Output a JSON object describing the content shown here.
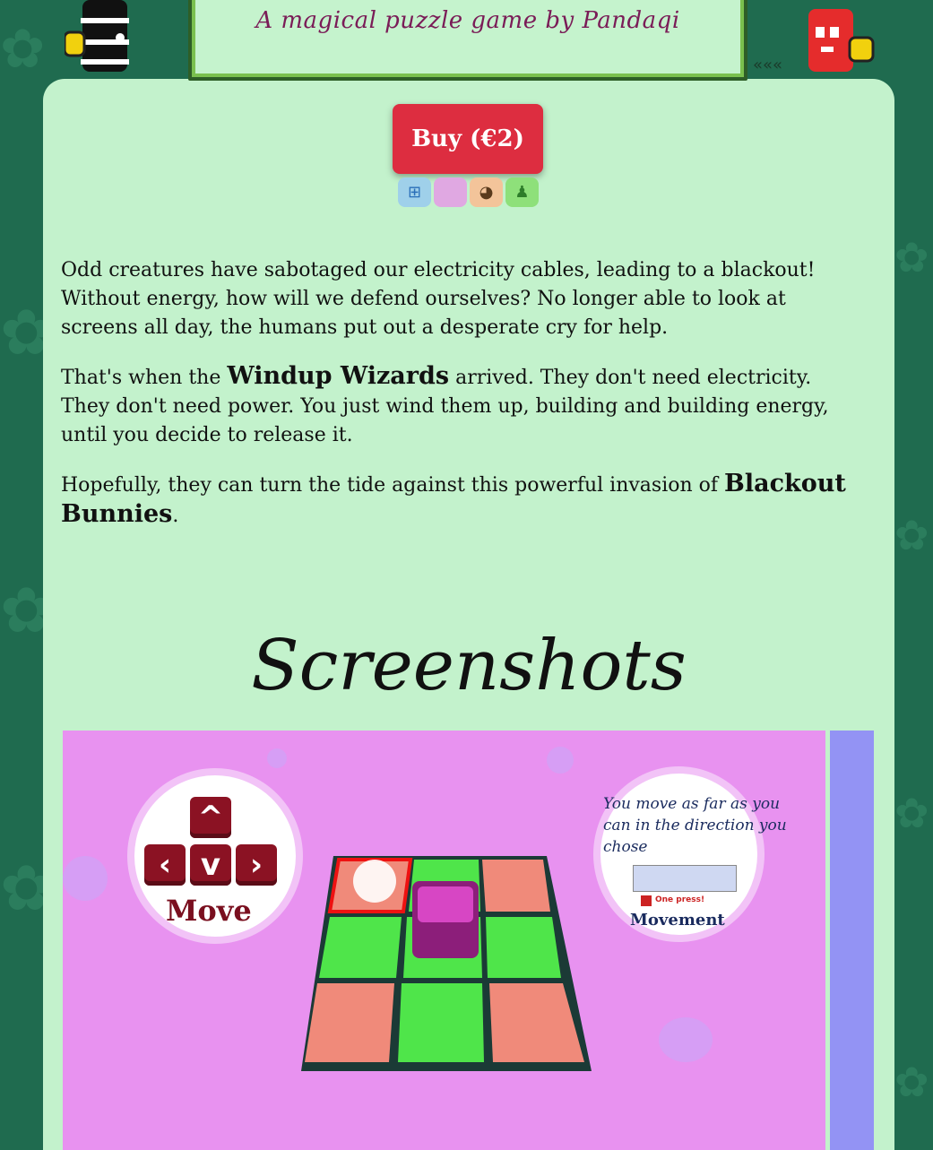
{
  "header": {
    "tagline": "A magical puzzle game by Pandaqi"
  },
  "buy": {
    "label": "Buy (€2)"
  },
  "platforms": [
    {
      "icon": "windows-icon",
      "color": "#9fd0ea"
    },
    {
      "icon": "apple-icon",
      "color": "#e0a8e2"
    },
    {
      "icon": "linux-icon",
      "color": "#f3c49a"
    },
    {
      "icon": "android-icon",
      "color": "#8ee07a"
    }
  ],
  "story": {
    "p1": "Odd creatures have sabotaged our electricity cables, leading to a blackout! Without energy, how will we defend ourselves? No longer able to look at screens all day, the humans put out a desperate cry for help.",
    "p2_before": "That's when the ",
    "p2_strong": "Windup Wizards",
    "p2_after": " arrived. They don't need electricity. They don't need power. You just wind them up, building and building energy, until you decide to release it.",
    "p3_before": "Hopefully, they can turn the tide against this powerful invasion of ",
    "p3_strong": "Blackout Bunnies",
    "p3_after": "."
  },
  "screenshots": {
    "title": "Screenshots",
    "slide1": {
      "move_label": "Move",
      "hint_line1": "You move as far as you",
      "hint_line2": "can in the direction you",
      "hint_line3": "chose",
      "one_press": "One press!",
      "movement_label": "Movement"
    }
  },
  "colors": {
    "background": "#1f6b4f",
    "panel": "#c3f2cc",
    "buy": "#dd2d40",
    "slide1": "#e892f0",
    "slide2": "#9393f4"
  }
}
